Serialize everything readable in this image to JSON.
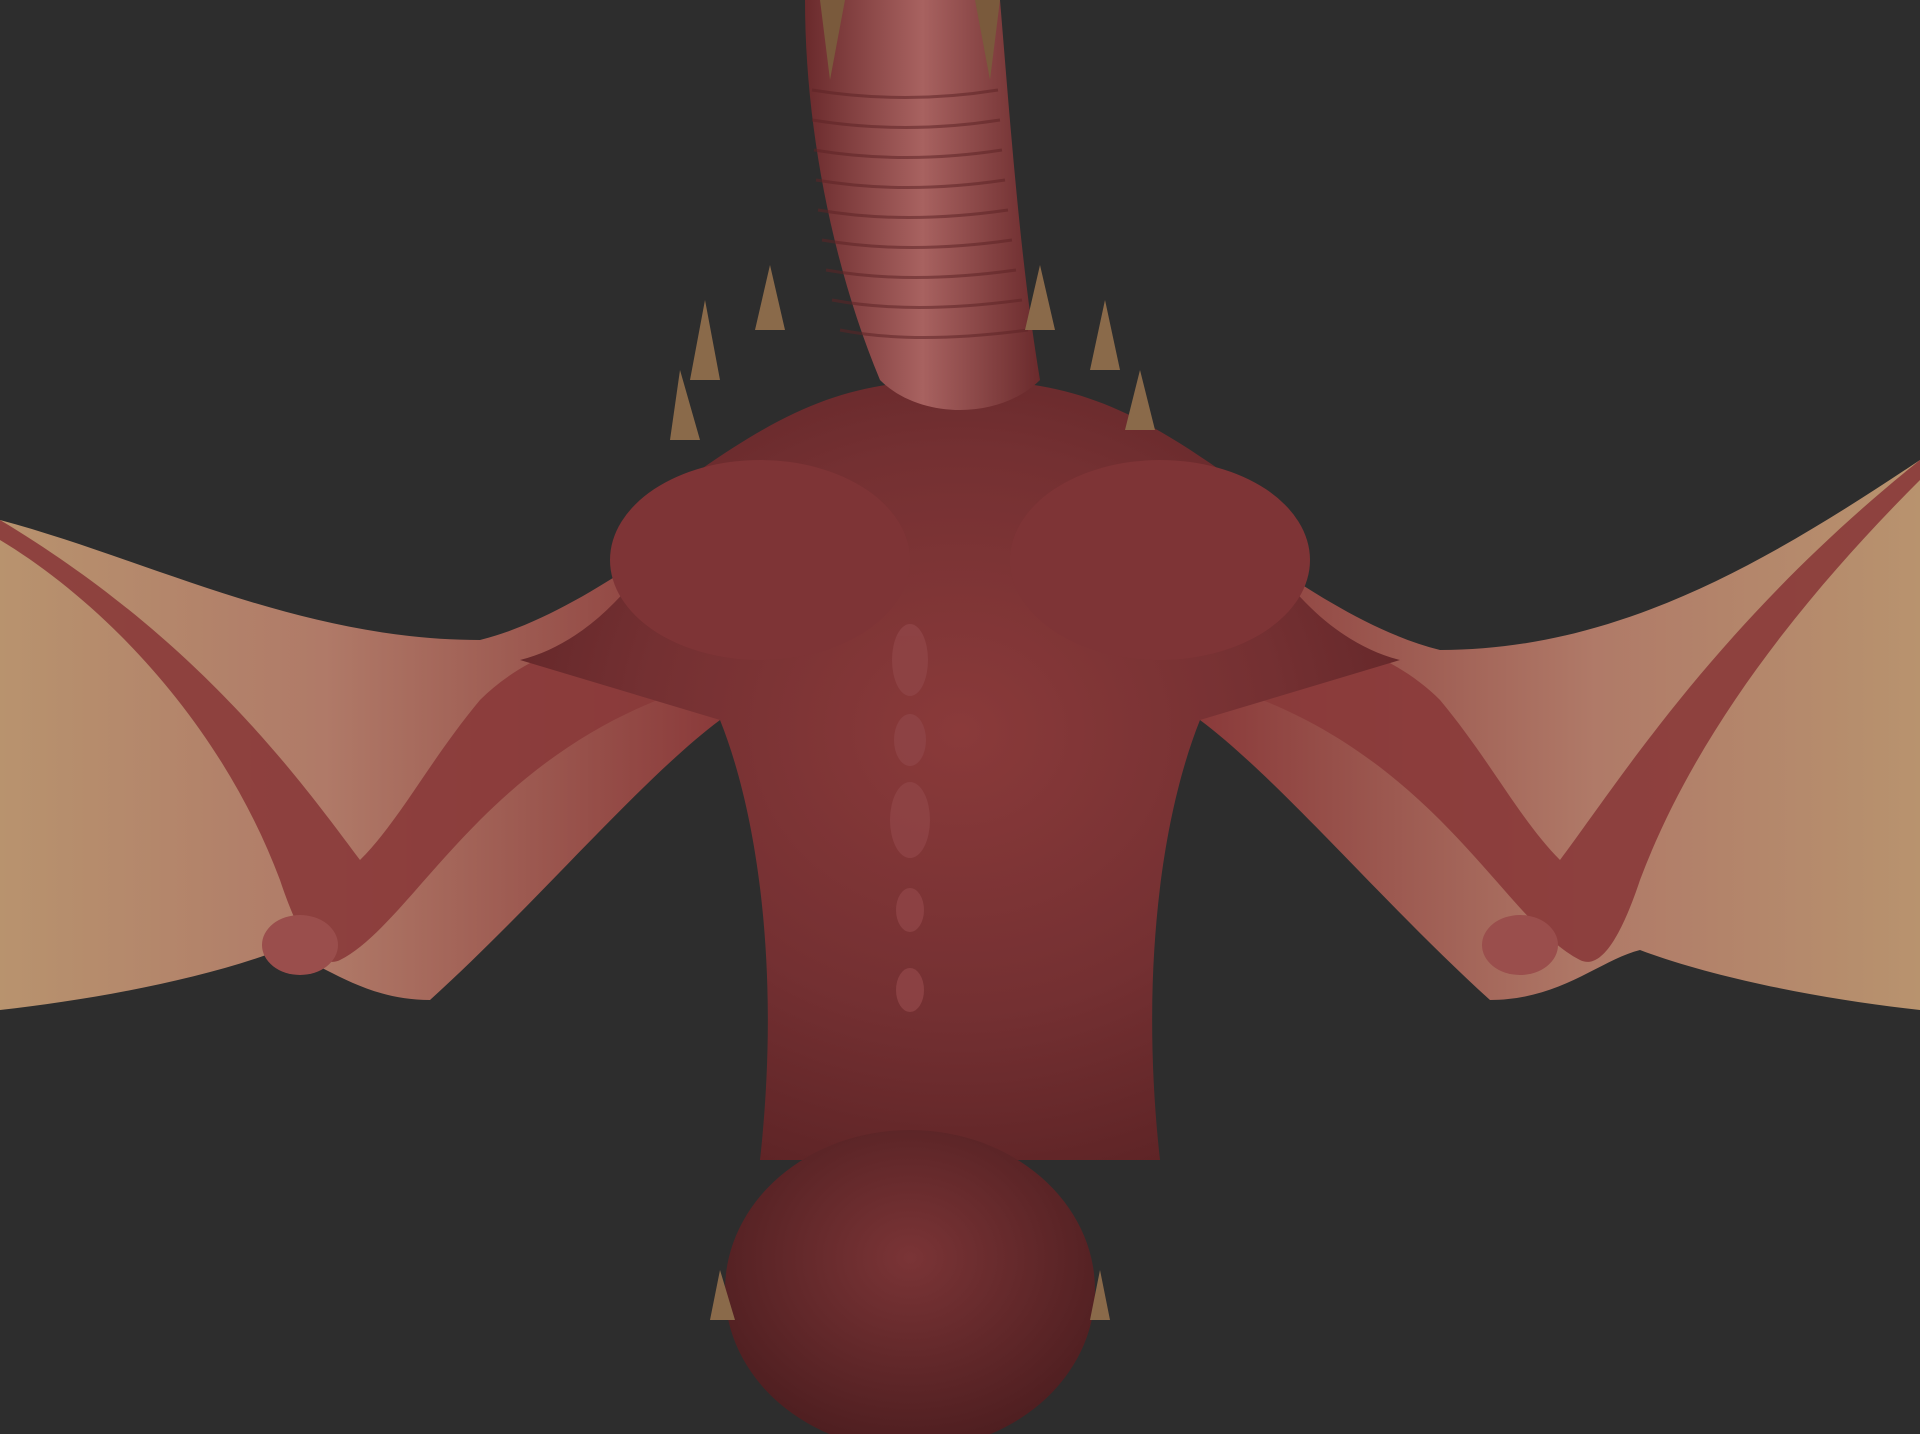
{
  "viewport": {
    "background_color": "#2d2d2d"
  },
  "model": {
    "subject": "dragon-sculpt-underside",
    "colors": {
      "skin_dark": "#5e2426",
      "skin_mid": "#8a3a3a",
      "skin_light": "#a86260",
      "membrane": "#b07a68",
      "membrane_pale": "#b8936e",
      "horn": "#7a5a3c"
    }
  }
}
